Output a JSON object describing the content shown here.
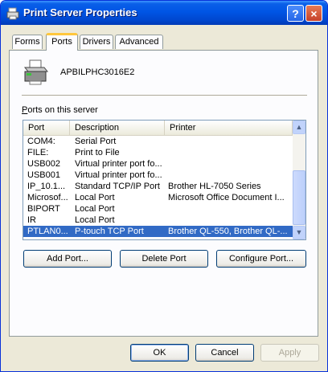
{
  "window": {
    "title": "Print Server Properties",
    "help_glyph": "?",
    "close_glyph": "×"
  },
  "tabs": [
    {
      "label": "Forms",
      "active": false
    },
    {
      "label": "Ports",
      "active": true
    },
    {
      "label": "Drivers",
      "active": false
    },
    {
      "label": "Advanced",
      "active": false
    }
  ],
  "server": {
    "name": "APBILPHC3016E2"
  },
  "ports_label": {
    "prefix": "P",
    "rest": "orts on this server"
  },
  "list": {
    "columns": {
      "port": "Port",
      "description": "Description",
      "printer": "Printer"
    },
    "rows": [
      {
        "port": "COM4:",
        "description": "Serial Port",
        "printer": ""
      },
      {
        "port": "FILE:",
        "description": "Print to File",
        "printer": ""
      },
      {
        "port": "USB002",
        "description": "Virtual printer port fo...",
        "printer": ""
      },
      {
        "port": "USB001",
        "description": "Virtual printer port fo...",
        "printer": ""
      },
      {
        "port": "IP_10.1...",
        "description": "Standard TCP/IP Port",
        "printer": "Brother HL-7050 Series"
      },
      {
        "port": "Microsof...",
        "description": "Local Port",
        "printer": "Microsoft Office Document I..."
      },
      {
        "port": "BIPORT",
        "description": "Local Port",
        "printer": ""
      },
      {
        "port": "IR",
        "description": "Local Port",
        "printer": ""
      },
      {
        "port": "PTLAN0...",
        "description": "P-touch TCP Port",
        "printer": "Brother QL-550, Brother QL-..."
      }
    ],
    "selected_index": 8,
    "scroll_up": "▲",
    "scroll_down": "▼"
  },
  "buttons": {
    "add_port": "Add Port...",
    "delete_port": "Delete Port",
    "configure_port": "Configure Port...",
    "ok": "OK",
    "cancel": "Cancel",
    "apply": "Apply"
  },
  "colors": {
    "title_bar": "#0055e5",
    "selection": "#316ac5",
    "tab_highlight": "#ffc73c"
  }
}
